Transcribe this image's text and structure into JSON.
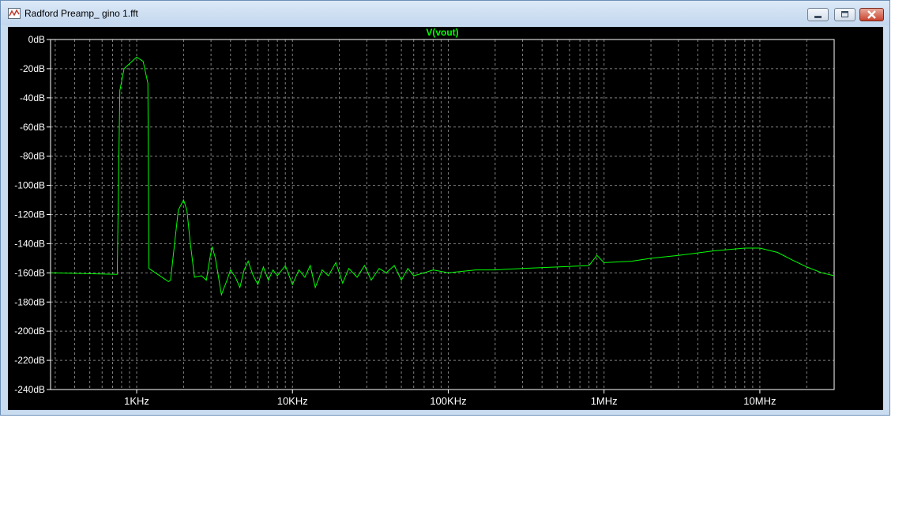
{
  "window": {
    "title": "Radford Preamp_  gino 1.fft",
    "controls": {
      "minimize": "minimize",
      "maximize": "maximize",
      "close": "close"
    }
  },
  "plot": {
    "background": "#000000",
    "trace_color": "#00ff00",
    "axis_text_color": "#ffffff",
    "grid_color": "#808080"
  },
  "chart_data": {
    "type": "line",
    "title": "V(vout)",
    "x_scale": "log",
    "xlim_hz": [
      280,
      30000000
    ],
    "ylim_db": [
      -240,
      0
    ],
    "y_ticks": [
      "0dB",
      "-20dB",
      "-40dB",
      "-60dB",
      "-80dB",
      "-100dB",
      "-120dB",
      "-140dB",
      "-160dB",
      "-180dB",
      "-200dB",
      "-220dB",
      "-240dB"
    ],
    "x_ticks": [
      {
        "value": 1000,
        "label": "1KHz"
      },
      {
        "value": 10000,
        "label": "10KHz"
      },
      {
        "value": 100000,
        "label": "100KHz"
      },
      {
        "value": 1000000,
        "label": "1MHz"
      },
      {
        "value": 10000000,
        "label": "10MHz"
      }
    ],
    "grid": true,
    "series": [
      {
        "name": "V(vout)",
        "color": "#00ff00",
        "points": [
          [
            280,
            -160
          ],
          [
            750,
            -161
          ],
          [
            780,
            -35
          ],
          [
            830,
            -20
          ],
          [
            1000,
            -12
          ],
          [
            1100,
            -15
          ],
          [
            1180,
            -30
          ],
          [
            1200,
            -157
          ],
          [
            1600,
            -166
          ],
          [
            1650,
            -165
          ],
          [
            1750,
            -140
          ],
          [
            1850,
            -117
          ],
          [
            2000,
            -110
          ],
          [
            2100,
            -117
          ],
          [
            2200,
            -138
          ],
          [
            2350,
            -163
          ],
          [
            2600,
            -162
          ],
          [
            2800,
            -165
          ],
          [
            2950,
            -150
          ],
          [
            3050,
            -142
          ],
          [
            3200,
            -150
          ],
          [
            3500,
            -175
          ],
          [
            3800,
            -165
          ],
          [
            4000,
            -158
          ],
          [
            4300,
            -163
          ],
          [
            4600,
            -170
          ],
          [
            4900,
            -158
          ],
          [
            5200,
            -152
          ],
          [
            5600,
            -162
          ],
          [
            6000,
            -168
          ],
          [
            6500,
            -156
          ],
          [
            7000,
            -165
          ],
          [
            7500,
            -158
          ],
          [
            8000,
            -162
          ],
          [
            9000,
            -155
          ],
          [
            10000,
            -168
          ],
          [
            11000,
            -158
          ],
          [
            12000,
            -163
          ],
          [
            13000,
            -155
          ],
          [
            14000,
            -170
          ],
          [
            15500,
            -158
          ],
          [
            17000,
            -162
          ],
          [
            19000,
            -153
          ],
          [
            21000,
            -167
          ],
          [
            23000,
            -157
          ],
          [
            26000,
            -163
          ],
          [
            29000,
            -155
          ],
          [
            32000,
            -165
          ],
          [
            36000,
            -157
          ],
          [
            40000,
            -160
          ],
          [
            45000,
            -155
          ],
          [
            50000,
            -165
          ],
          [
            55000,
            -157
          ],
          [
            60000,
            -162
          ],
          [
            70000,
            -160
          ],
          [
            80000,
            -158
          ],
          [
            100000,
            -160
          ],
          [
            150000,
            -158
          ],
          [
            200000,
            -158
          ],
          [
            300000,
            -157
          ],
          [
            500000,
            -156
          ],
          [
            800000,
            -155
          ],
          [
            900000,
            -148
          ],
          [
            1000000,
            -153
          ],
          [
            1500000,
            -152
          ],
          [
            2000000,
            -150
          ],
          [
            3000000,
            -148
          ],
          [
            5000000,
            -145
          ],
          [
            8000000,
            -143
          ],
          [
            10000000,
            -143
          ],
          [
            13000000,
            -146
          ],
          [
            16000000,
            -151
          ],
          [
            20000000,
            -156
          ],
          [
            25000000,
            -160
          ],
          [
            30000000,
            -162
          ]
        ]
      }
    ]
  }
}
